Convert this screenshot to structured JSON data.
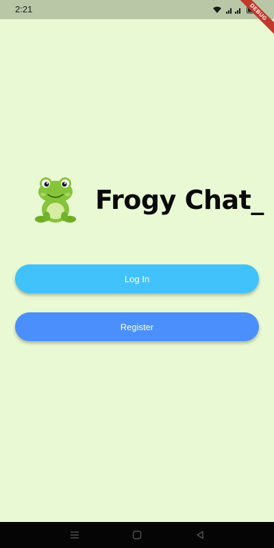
{
  "status_bar": {
    "time": "2:21",
    "icons": [
      "wifi-icon",
      "signal-icon",
      "battery-icon"
    ]
  },
  "debug_banner": "DEBUG",
  "app": {
    "title": "Frogy Chat_",
    "logo": "frog-logo"
  },
  "buttons": {
    "login_label": "Log In",
    "register_label": "Register"
  },
  "colors": {
    "background": "#e9f9d3",
    "login_button": "#42c2fb",
    "register_button": "#4a8ffb",
    "nav_bar": "#050505"
  },
  "nav_bar": {
    "items": [
      "menu-icon",
      "home-icon",
      "back-icon"
    ]
  }
}
